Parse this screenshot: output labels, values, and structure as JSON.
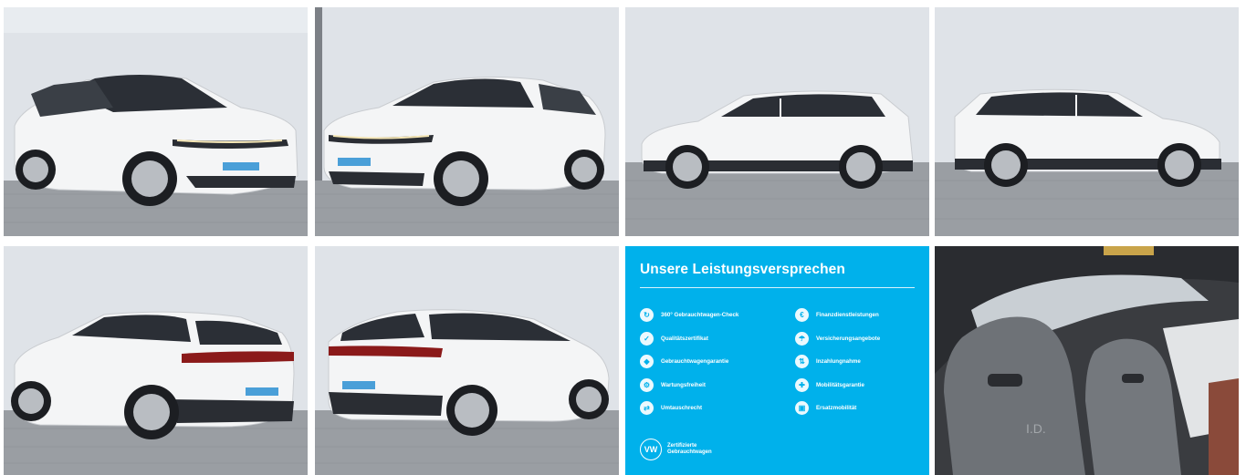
{
  "gallery": {
    "photos": [
      {
        "icon": "car-front-left-photo"
      },
      {
        "icon": "car-front-right-photo"
      },
      {
        "icon": "car-side-left-photo"
      },
      {
        "icon": "car-side-right-photo"
      },
      {
        "icon": "car-rear-left-photo"
      },
      {
        "icon": "car-rear-right-photo"
      },
      {
        "icon": "car-interior-seats-photo"
      }
    ],
    "promo": {
      "title": "Unsere Leistungsversprechen",
      "left_items": [
        "360° Gebrauchtwagen-Check",
        "Qualitätszertifikat",
        "Gebrauchtwagengarantie",
        "Wartungsfreiheit",
        "Umtauschrecht"
      ],
      "right_items": [
        "Finanzdienstleistungen",
        "Versicherungsangebote",
        "Inzahlungnahme",
        "Mobilitätsgarantie",
        "Ersatzmobilität"
      ],
      "cert_line1": "Zertifizierte",
      "cert_line2": "Gebrauchtwagen",
      "logo_text": "VW",
      "background": "#00b1eb"
    }
  }
}
